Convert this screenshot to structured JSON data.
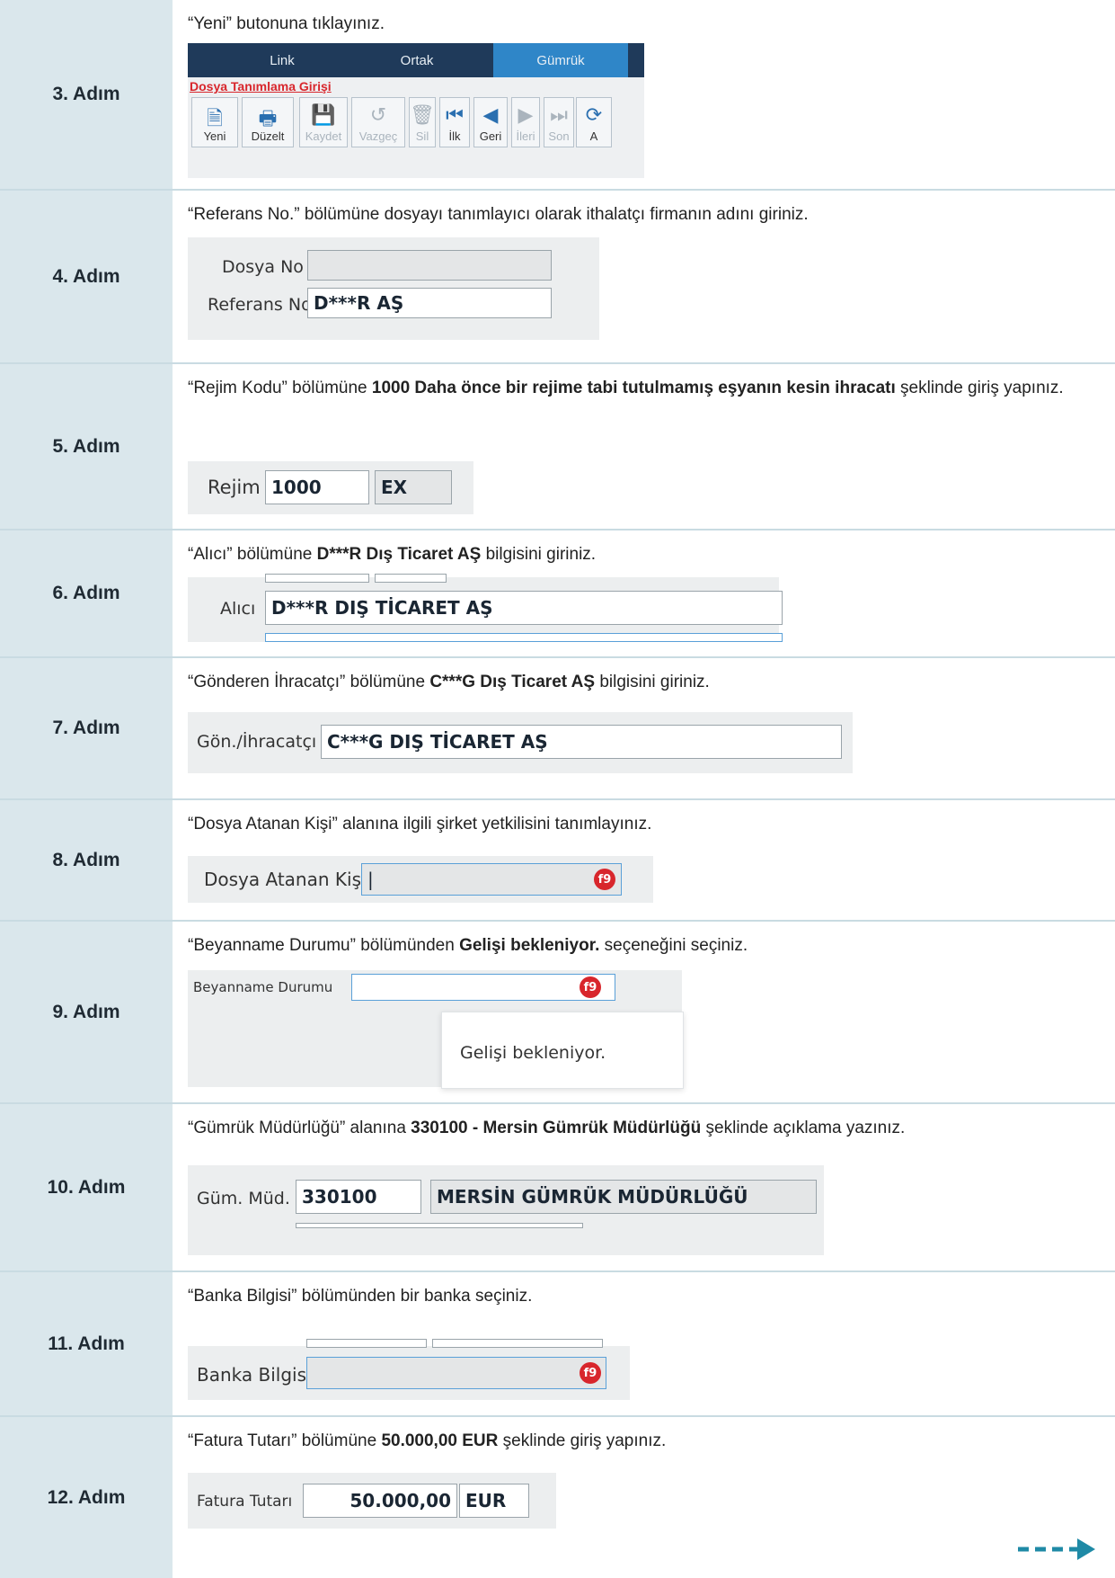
{
  "steps": [
    {
      "label": "3. Adım",
      "instruction_parts": [
        {
          "t": "“Yeni” butonuna tıklayınız.",
          "b": false
        }
      ]
    },
    {
      "label": "4. Adım",
      "instruction_parts": [
        {
          "t": "“Referans No.”  bölümüne dosyayı tanımlayıcı olarak ithalatçı firmanın adını giriniz.",
          "b": false
        }
      ]
    },
    {
      "label": "5. Adım",
      "instruction_parts": [
        {
          "t": "“Rejim Kodu” bölümüne  ",
          "b": false
        },
        {
          "t": "1000 Daha önce bir rejime tabi tutulmamış eşyanın kesin ihracatı",
          "b": true
        },
        {
          "t": " şeklinde giriş yapınız.",
          "b": false
        }
      ]
    },
    {
      "label": "6. Adım",
      "instruction_parts": [
        {
          "t": "“Alıcı” bölümüne ",
          "b": false
        },
        {
          "t": "D***R Dış Ticaret AŞ",
          "b": true
        },
        {
          "t": " bilgisini giriniz.",
          "b": false
        }
      ]
    },
    {
      "label": "7. Adım",
      "instruction_parts": [
        {
          "t": "“Gönderen İhracatçı” bölümüne ",
          "b": false
        },
        {
          "t": "C***G Dış Ticaret AŞ",
          "b": true
        },
        {
          "t": " bilgisini giriniz.",
          "b": false
        }
      ]
    },
    {
      "label": "8. Adım",
      "instruction_parts": [
        {
          "t": "“Dosya Atanan Kişi” alanına ilgili şirket yetkilisini tanımlayınız.",
          "b": false
        }
      ]
    },
    {
      "label": "9. Adım",
      "instruction_parts": [
        {
          "t": "“Beyanname Durumu” bölümünden ",
          "b": false
        },
        {
          "t": "Gelişi bekleniyor.",
          "b": true
        },
        {
          "t": " seçeneğini seçiniz.",
          "b": false
        }
      ]
    },
    {
      "label": "10. Adım",
      "instruction_parts": [
        {
          "t": "“Gümrük Müdürlüğü” alanına ",
          "b": false
        },
        {
          "t": "330100 - Mersin Gümrük Müdürlüğü",
          "b": true
        },
        {
          "t": " şeklinde açıklama yazınız.",
          "b": false
        }
      ]
    },
    {
      "label": "11. Adım",
      "instruction_parts": [
        {
          "t": "“Banka Bilgisi” bölümünden bir banka seçiniz.",
          "b": false
        }
      ]
    },
    {
      "label": "12. Adım",
      "instruction_parts": [
        {
          "t": "“Fatura Tutarı” bölümüne ",
          "b": false
        },
        {
          "t": "50.000,00 EUR",
          "b": true
        },
        {
          "t": " şeklinde giriş yapınız.",
          "b": false
        }
      ]
    }
  ],
  "toolbar": {
    "tabs": [
      "Link",
      "Ortak",
      "Gümrük"
    ],
    "form_title": "Dosya Tanımlama Girişi",
    "buttons": [
      {
        "label": "Yeni",
        "icon": "new-doc-icon"
      },
      {
        "label": "Düzelt",
        "icon": "edit-icon"
      },
      {
        "label": "Kaydet",
        "icon": "save-icon"
      },
      {
        "label": "Vazgeç",
        "icon": "undo-icon"
      },
      {
        "label": "Sil",
        "icon": "trash-icon"
      },
      {
        "label": "İlk",
        "icon": "first-icon"
      },
      {
        "label": "Geri",
        "icon": "back-icon"
      },
      {
        "label": "İleri",
        "icon": "forward-icon"
      },
      {
        "label": "Son",
        "icon": "last-icon"
      },
      {
        "label": "A",
        "icon": "refresh-icon"
      }
    ]
  },
  "fields": {
    "dosya_no_label": "Dosya No",
    "dosya_no_value": "",
    "referans_no_label": "Referans No",
    "referans_no_value": "D***R AŞ",
    "rejim_label": "Rejim",
    "rejim_value": "1000",
    "rejim_type": "EX",
    "alici_label": "Alıcı",
    "alici_value": "D***R DIŞ TİCARET AŞ",
    "gonderen_label": "Gön./İhracatçı",
    "gonderen_value": "C***G DIŞ TİCARET AŞ",
    "dosya_atanan_label": "Dosya Atanan Kişi",
    "dosya_atanan_value": "|",
    "beyanname_label": "Beyanname Durumu",
    "beyanname_option": "Gelişi bekleniyor.",
    "gum_mud_label": "Güm. Müd.",
    "gum_mud_code": "330100",
    "gum_mud_name": "MERSİN GÜMRÜK MÜDÜRLÜĞÜ",
    "banka_label": "Banka Bilgisi",
    "banka_value": "",
    "fatura_label": "Fatura Tutarı",
    "fatura_value": "50.000,00",
    "fatura_currency": "EUR",
    "f9_badge": "f9"
  },
  "colors": {
    "step_bg": "#dae7ec",
    "tab_bar": "#1f3a5a",
    "tab_active": "#2f86c8",
    "badge": "#d8262c",
    "arrow": "#1f8aa6"
  }
}
